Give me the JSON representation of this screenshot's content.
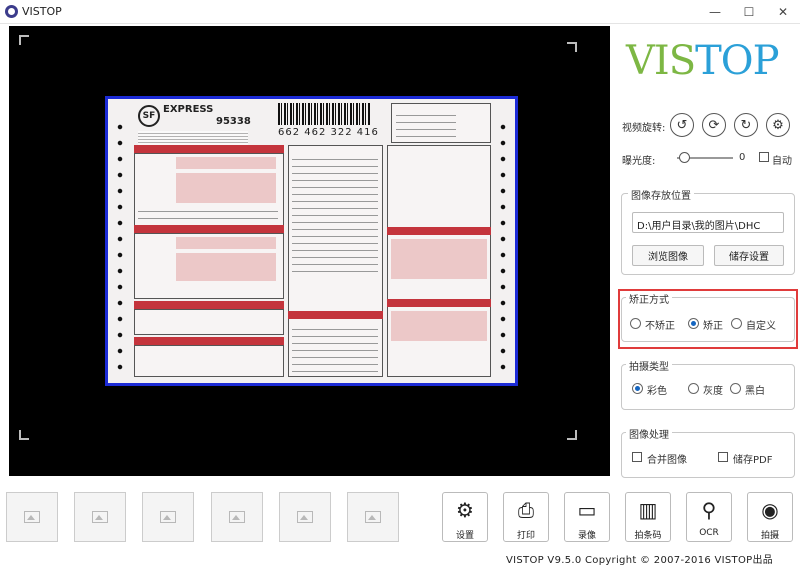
{
  "window": {
    "title": "VISTOP",
    "minimize": "—",
    "maximize": "☐",
    "close": "✕"
  },
  "logo": {
    "part1": "VIS",
    "part2": "TOP"
  },
  "document_preview": {
    "logo": "SF",
    "brand": "EXPRESS",
    "hotline": "95338",
    "tracking_number": "662 462 322 416"
  },
  "rotation": {
    "label": "视频旋转:",
    "buttons": [
      {
        "icon": "rotate-left-icon",
        "glyph": "↺"
      },
      {
        "icon": "rotate-reset-icon",
        "glyph": "⟳"
      },
      {
        "icon": "rotate-right-icon",
        "glyph": "↻"
      },
      {
        "icon": "settings-icon",
        "glyph": "⚙"
      }
    ]
  },
  "exposure": {
    "label": "曝光度:",
    "value": "0",
    "level": 0,
    "auto_label": "自动"
  },
  "storage": {
    "title": "图像存放位置",
    "path": "D:\\用户目录\\我的图片\\DHC",
    "browse": "浏览图像",
    "save_settings": "储存设置"
  },
  "correction": {
    "title": "矫正方式",
    "options": [
      {
        "label": "不矫正",
        "checked": false
      },
      {
        "label": "矫正",
        "checked": true
      },
      {
        "label": "自定义",
        "checked": false
      }
    ]
  },
  "capture_type": {
    "title": "拍摄类型",
    "options": [
      {
        "label": "彩色",
        "checked": true
      },
      {
        "label": "灰度",
        "checked": false
      },
      {
        "label": "黑白",
        "checked": false
      }
    ]
  },
  "image_processing": {
    "title": "图像处理",
    "merge_label": "合并图像",
    "pdf_label": "储存PDF"
  },
  "toolbar": {
    "settings": "设置",
    "print": "打印",
    "record": "录像",
    "barcode": "拍条码",
    "ocr": "OCR",
    "capture": "拍摄"
  },
  "footer": {
    "copyright": "VISTOP V9.5.0 Copyright © 2007-2016 VISTOP出品"
  },
  "colors": {
    "accent_highlight": "#e03b3b",
    "logo_green": "#7db744",
    "logo_blue": "#2ba0d8",
    "document_border": "#1c2bd6"
  }
}
